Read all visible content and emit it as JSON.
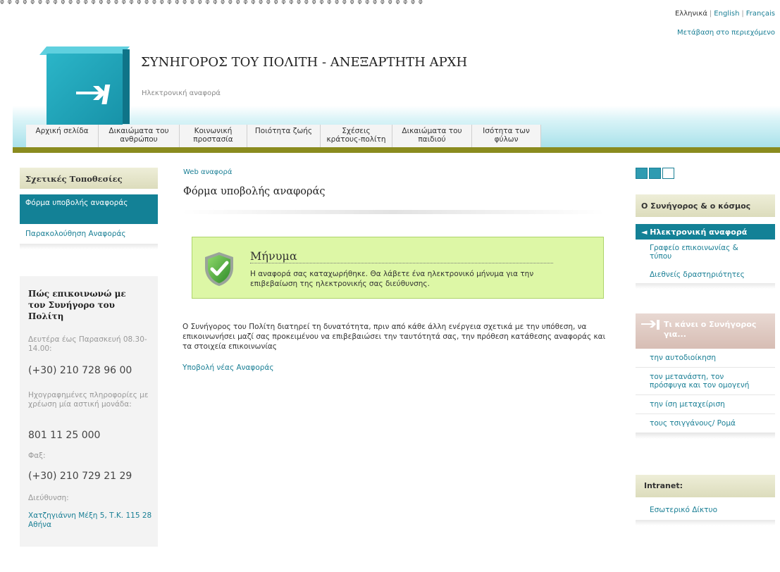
{
  "top_strip": {
    "text": "φ φ φ φ φ φ φ φ φ φ φ φ φ φ φ φ φ φ φ φ φ φ φ φ φ φ φ φ φ φ φ φ φ φ φ φ φ φ φ φ φ φ φ φ φ φ φ φ φ φ φ φ φ φ φ φ"
  },
  "languages": {
    "greek": "Ελληνικά",
    "english": "English",
    "french": "Français",
    "separator": "|"
  },
  "skip_link": "Μετάβαση στο περιεχόμενο",
  "header": {
    "title": "ΣΥΝΗΓΟΡΟΣ ΤΟΥ ΠΟΛΙΤΗ - ΑΝΕΞΑΡΤΗΤΗ ΑΡΧΗ",
    "subtitle": "Ηλεκτρονική αναφορά",
    "logo_icon": "arrow-logo-icon"
  },
  "nav": [
    {
      "l1": "Αρχική σελίδα",
      "l2": ""
    },
    {
      "l1": "Δικαιώματα του",
      "l2": "ανθρώπου"
    },
    {
      "l1": "Κοινωνική",
      "l2": "προστασία"
    },
    {
      "l1": "Ποιότητα ζωής",
      "l2": ""
    },
    {
      "l1": "Σχέσεις",
      "l2": "κράτους-πολίτη"
    },
    {
      "l1": "Δικαιώματα του",
      "l2": "παιδιού"
    },
    {
      "l1": "Ισότητα των",
      "l2": "φύλων"
    }
  ],
  "left_sidebar": {
    "title": "Σχετικές Τοποθεσίες",
    "active_item": "Φόρμα υποβολής αναφοράς",
    "item": "Παρακολούθηση Αναφοράς"
  },
  "contact": {
    "title": "Πώς επικοινωνώ με τον Συνήγορο του Πολίτη",
    "hours_label": "Δευτέρα έως Παρασκευή 08.30-14.00:",
    "phone": "(+30) 210 728 96 00",
    "recorded_label": "Ηχογραφημένες πληροφορίες με χρέωση μία αστική μονάδα:",
    "recorded_phone": "801 11 25 000",
    "fax_label": "Φαξ:",
    "fax": "(+30) 210 729 21 29",
    "address_label": "Διεύθυνση:",
    "address": "Χατζηγιάννη Μέξη 5, Τ.Κ. 115 28 Αθήνα"
  },
  "main": {
    "breadcrumb": "Web αναφορά",
    "page_title": "Φόρμα υποβολής αναφοράς",
    "message": {
      "title": "Μήνυμα",
      "text": "Η αναφορά σας καταχωρήθηκε. Θα λάβετε ένα ηλεκτρονικό μήνυμα για την επιβεβαίωση της ηλεκτρονικής σας διεύθυνσης.",
      "icon": "shield-check-icon"
    },
    "body_text": "Ο Συνήγορος του Πολίτη διατηρεί τη δυνατότητα, πριν από κάθε άλλη ενέργεια σχετικά με την υπόθεση, να επικοινωνήσει μαζί σας προκειμένου να επιβεβαιώσει την ταυτότητά σας, την πρόθεση κατάθεσης αναφοράς και τα στοιχεία επικοινωνίας",
    "new_report_link": "Υποβολή νέας Αναφοράς"
  },
  "right_sidebar": {
    "box1": {
      "title": "Ο Συνήγορος & ο κόσμος",
      "active": "◄ Ηλεκτρονική αναφορά",
      "items": [
        "Γραφείο επικοινωνίας & τύπου",
        "Διεθνείς δραστηριότητες"
      ]
    },
    "box2": {
      "title": "Τι κάνει ο Συνήγορος για...",
      "items": [
        "την αυτοδιοίκηση",
        "τον μετανάστη, τον πρόσφυγα και τον ομογενή",
        "την ίση μεταχείριση",
        "τους τσιγγάνους/ Ρομά"
      ]
    },
    "box3": {
      "title": "Intranet:",
      "items": [
        "Εσωτερικό Δίκτυο"
      ]
    }
  },
  "colors": {
    "accent_teal": "#138196",
    "olive_bar": "#8a8b1f",
    "message_bg": "#ddf7a6"
  }
}
